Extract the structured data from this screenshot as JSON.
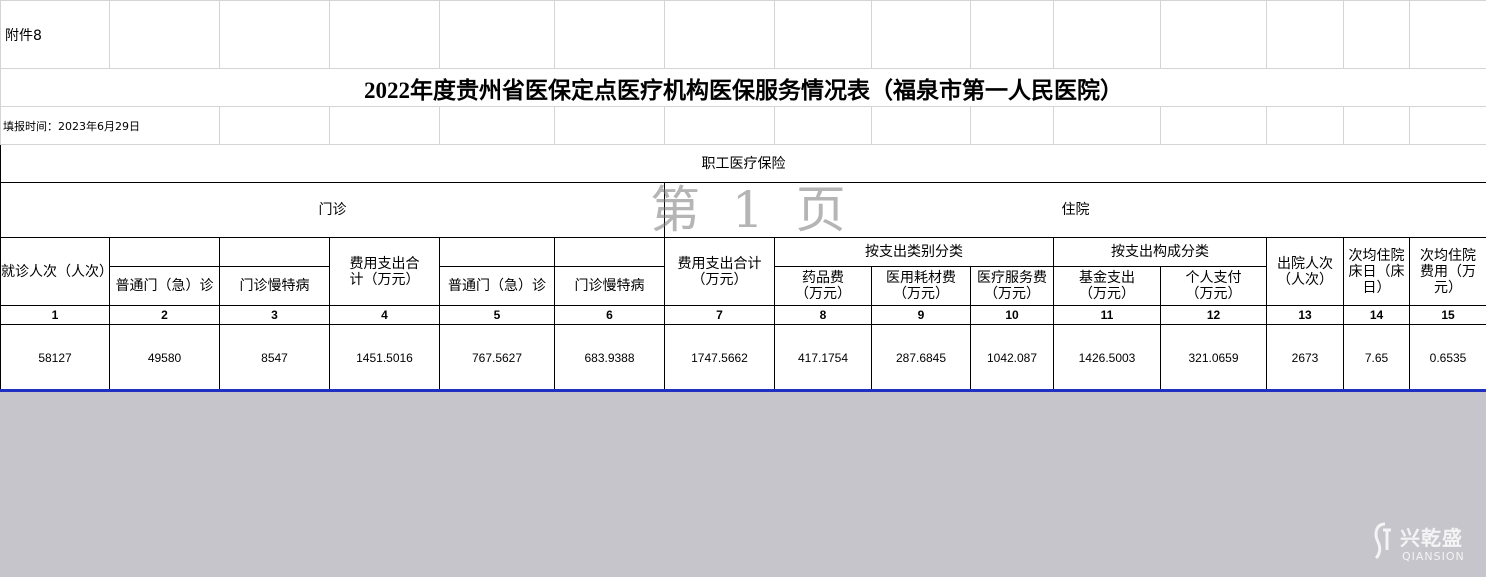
{
  "sheet": {
    "attachment_label": "附件8",
    "title": "2022年度贵州省医保定点医疗机构医保服务情况表（福泉市第一人民医院）",
    "fill_date": "填报时间：2023年6月29日",
    "section_employee": "职工医疗保险",
    "section_outpatient": "门诊",
    "section_inpatient": "住院",
    "page_watermark": "第 1 页"
  },
  "headers": {
    "visits": "就诊人次（人次）",
    "general_outpatient": "普通门（急）诊",
    "chronic_outpatient": "门诊慢特病",
    "total_expense_outpatient": "费用支出合计（万元）",
    "general_outpatient_2": "普通门（急）诊",
    "chronic_outpatient_2": "门诊慢特病",
    "total_expense_inpatient": "费用支出合计（万元）",
    "by_expense_category": "按支出类别分类",
    "drug_fee": "药品费（万元）",
    "consumables_fee": "医用耗材费（万元）",
    "service_fee": "医疗服务费（万元）",
    "by_expense_composition": "按支出构成分类",
    "fund_expense": "基金支出（万元）",
    "personal_payment": "个人支付（万元）",
    "discharges": "出院人次（人次）",
    "avg_bed_days": "次均住院床日（床日）",
    "avg_inpatient_cost": "次均住院费用（万元）"
  },
  "index_row": [
    "1",
    "2",
    "3",
    "4",
    "5",
    "6",
    "7",
    "8",
    "9",
    "10",
    "11",
    "12",
    "13",
    "14",
    "15"
  ],
  "data_row": [
    "58127",
    "49580",
    "8547",
    "1451.5016",
    "767.5627",
    "683.9388",
    "1747.5662",
    "417.1754",
    "287.6845",
    "1042.087",
    "1426.5003",
    "321.0659",
    "2673",
    "7.65",
    "0.6535"
  ],
  "brand": {
    "name": "兴乾盛",
    "sub": "QIANSION"
  }
}
